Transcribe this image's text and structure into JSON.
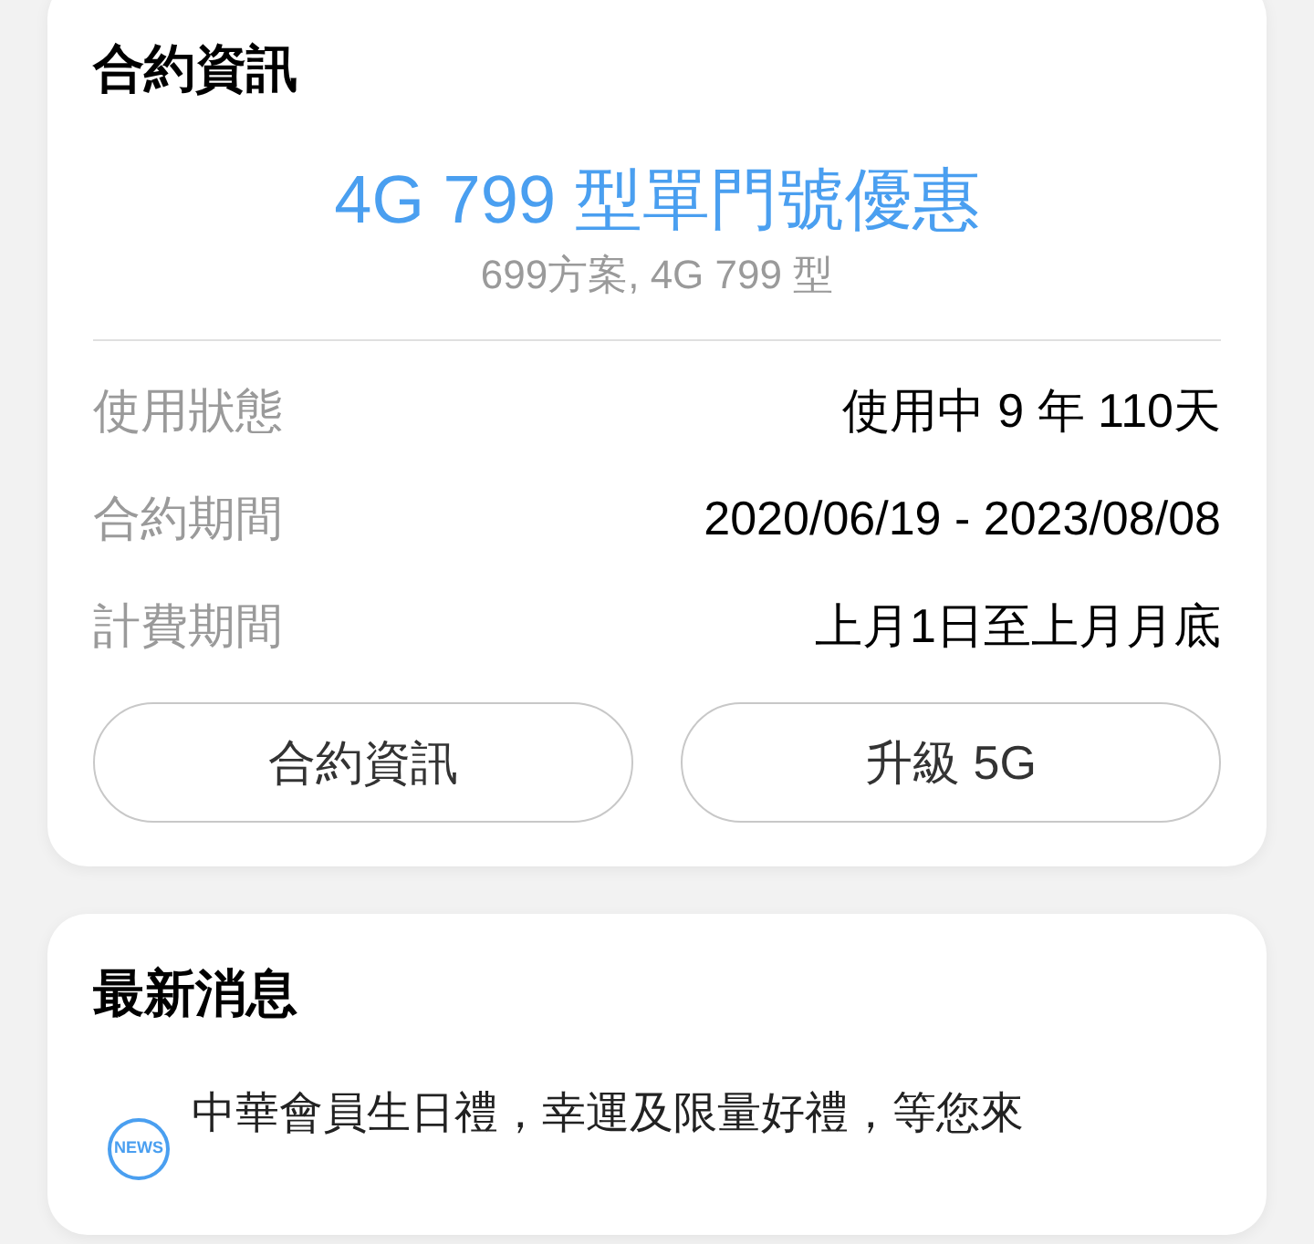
{
  "contract_card": {
    "title": "合約資訊",
    "plan_name": "4G 799 型單門號優惠",
    "plan_detail": "699方案, 4G 799 型",
    "rows": [
      {
        "label": "使用狀態",
        "value": "使用中 9 年 110天"
      },
      {
        "label": "合約期間",
        "value": "2020/06/19 - 2023/08/08"
      },
      {
        "label": "計費期間",
        "value": "上月1日至上月月底"
      }
    ],
    "buttons": [
      "合約資訊",
      "升級 5G"
    ]
  },
  "news_card": {
    "title": "最新消息",
    "items": [
      {
        "badge": "NEWS",
        "text": "中華會員生日禮，幸運及限量好禮，等您來"
      }
    ]
  }
}
